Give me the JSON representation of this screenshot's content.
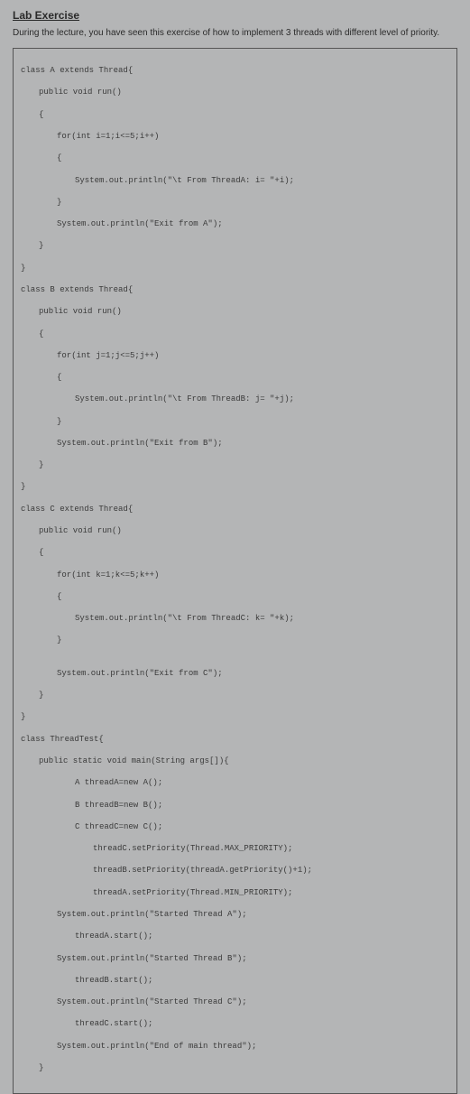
{
  "heading": "Lab Exercise",
  "intro": "During the lecture, you have seen this exercise of how to implement 3 threads with different level of priority.",
  "code": {
    "l01": "class A extends Thread{",
    "l02": "public void run()",
    "l03": "{",
    "l04": "for(int i=1;i<=5;i++)",
    "l05": "{",
    "l06": "System.out.println(\"\\t From ThreadA: i= \"+i);",
    "l07": "}",
    "l08": "System.out.println(\"Exit from A\");",
    "l09": "}",
    "l10": "}",
    "l11": "class B extends Thread{",
    "l12": "public void run()",
    "l13": "{",
    "l14": "for(int j=1;j<=5;j++)",
    "l15": "{",
    "l16": "System.out.println(\"\\t From ThreadB: j= \"+j);",
    "l17": "}",
    "l18": "System.out.println(\"Exit from B\");",
    "l19": "}",
    "l20": "}",
    "l21": "class C extends Thread{",
    "l22": "public void run()",
    "l23": "{",
    "l24": "for(int k=1;k<=5;k++)",
    "l25": "{",
    "l26": "System.out.println(\"\\t From ThreadC: k= \"+k);",
    "l27": "}",
    "blank1": "",
    "l28": "System.out.println(\"Exit from C\");",
    "l29": "}",
    "l30": "}",
    "l31": "class ThreadTest{",
    "l32": "public static void main(String args[]){",
    "l33": "A threadA=new A();",
    "l34": "B threadB=new B();",
    "l35": "C threadC=new C();",
    "l36": "threadC.setPriority(Thread.MAX_PRIORITY);",
    "l37": "threadB.setPriority(threadA.getPriority()+1);",
    "l38": "threadA.setPriority(Thread.MIN_PRIORITY);",
    "l39": "System.out.println(\"Started Thread A\");",
    "l40": "threadA.start();",
    "l41": "System.out.println(\"Started Thread B\");",
    "l42": "threadB.start();",
    "l43": "System.out.println(\"Started Thread C\");",
    "l44": "threadC.start();",
    "l45": "System.out.println(\"End of main thread\");",
    "l46": "}"
  }
}
